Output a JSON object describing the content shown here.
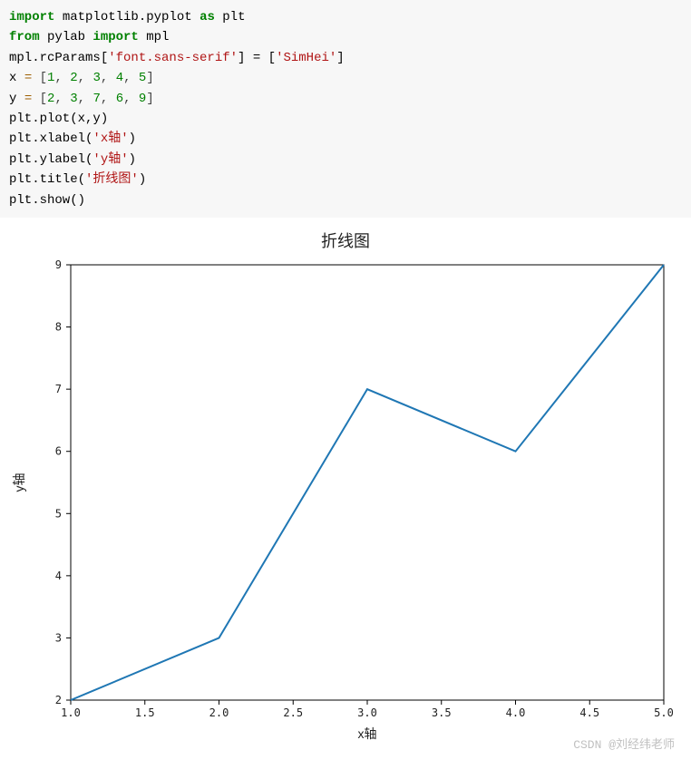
{
  "code": {
    "l1_a": "import",
    "l1_b": " matplotlib.pyplot ",
    "l1_c": "as",
    "l1_d": " plt",
    "l2_a": "from",
    "l2_b": " pylab ",
    "l2_c": "import",
    "l2_d": " mpl",
    "l3_a": "mpl.rcParams[",
    "l3_b": "'font.sans-serif'",
    "l3_c": "] = [",
    "l3_d": "'SimHei'",
    "l3_e": "]",
    "l4_a": "x ",
    "l4_b": "=",
    "l4_c": " [",
    "l4_n1": "1",
    "l4_n2": "2",
    "l4_n3": "3",
    "l4_n4": "4",
    "l4_n5": "5",
    "l4_d": "]",
    "l5_a": "y ",
    "l5_b": "=",
    "l5_c": " [",
    "l5_n1": "2",
    "l5_n2": "3",
    "l5_n3": "7",
    "l5_n4": "6",
    "l5_n5": "9",
    "l5_d": "]",
    "l6_a": "plt.plot(x,y)",
    "l7_a": "plt.xlabel(",
    "l7_b": "'x轴'",
    "l7_c": ")",
    "l8_a": "plt.ylabel(",
    "l8_b": "'y轴'",
    "l8_c": ")",
    "l9_a": "plt.title(",
    "l9_b": "'折线图'",
    "l9_c": ")",
    "l10_a": "plt.show()",
    "comma": ", "
  },
  "chart_data": {
    "type": "line",
    "x": [
      1,
      2,
      3,
      4,
      5
    ],
    "y": [
      2,
      3,
      7,
      6,
      9
    ],
    "title": "折线图",
    "xlabel": "x轴",
    "ylabel": "y轴",
    "xlim": [
      1.0,
      5.0
    ],
    "ylim": [
      2,
      9
    ],
    "xticks": [
      1.0,
      1.5,
      2.0,
      2.5,
      3.0,
      3.5,
      4.0,
      4.5,
      5.0
    ],
    "yticks": [
      2,
      3,
      4,
      5,
      6,
      7,
      8,
      9
    ],
    "xtick_labels": [
      "1.0",
      "1.5",
      "2.0",
      "2.5",
      "3.0",
      "3.5",
      "4.0",
      "4.5",
      "5.0"
    ],
    "ytick_labels": [
      "2",
      "3",
      "4",
      "5",
      "6",
      "7",
      "8",
      "9"
    ]
  },
  "watermark": "CSDN @刘经纬老师"
}
